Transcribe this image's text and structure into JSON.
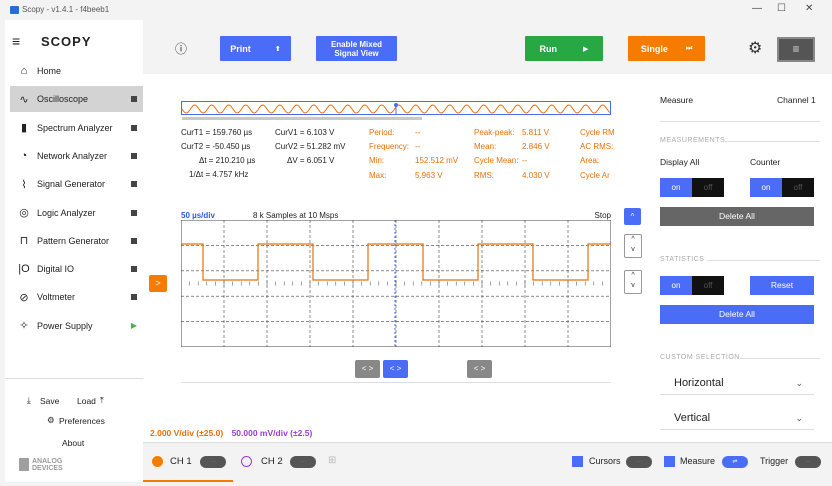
{
  "window": {
    "title": "Scopy - v1.4.1 - f4beeb1",
    "min": "—",
    "max": "☐",
    "close": "✕"
  },
  "brand": "SCOPY",
  "nav": [
    {
      "label": "Home",
      "icon": "home-icon",
      "glyph": "⌂"
    },
    {
      "label": "Oscilloscope",
      "icon": "oscilloscope-icon",
      "glyph": "∿"
    },
    {
      "label": "Spectrum Analyzer",
      "icon": "spectrum-icon",
      "glyph": "▮"
    },
    {
      "label": "Network Analyzer",
      "icon": "network-icon",
      "glyph": "◔"
    },
    {
      "label": "Signal Generator",
      "icon": "signal-icon",
      "glyph": "⌇"
    },
    {
      "label": "Logic Analyzer",
      "icon": "logic-icon",
      "glyph": "◎"
    },
    {
      "label": "Pattern Generator",
      "icon": "pattern-icon",
      "glyph": "⊓"
    },
    {
      "label": "Digital IO",
      "icon": "digital-io-icon",
      "glyph": "|O"
    },
    {
      "label": "Voltmeter",
      "icon": "voltmeter-icon",
      "glyph": "⊘"
    },
    {
      "label": "Power Supply",
      "icon": "power-icon",
      "glyph": "✧"
    }
  ],
  "sidebar_footer": {
    "save": "Save",
    "load": "Load",
    "preferences": "Preferences",
    "about": "About",
    "logo_line1": "ANALOG",
    "logo_line2": "DEVICES"
  },
  "toolbar": {
    "print": "Print",
    "mixed_line1": "Enable Mixed",
    "mixed_line2": "Signal View",
    "run": "Run",
    "single": "Single"
  },
  "colors": {
    "blue": "#4a6cf7",
    "green": "#27a844",
    "orange": "#f57c00",
    "ch1": "#e8700a",
    "ch2": "#9b3bd3"
  },
  "cursors": {
    "curT1": "CurT1 = 159.760 µs",
    "curT2": "CurT2 = -50.450 µs",
    "dt": "Δt = 210.210 µs",
    "inv_dt": "1/Δt = 4.757 kHz",
    "curV1": "CurV1 = 6.103 V",
    "curV2": "CurV2 = 51.282 mV",
    "dv": "ΔV = 6.051 V"
  },
  "measurements": {
    "period_label": "Period:",
    "period_val": "--",
    "freq_label": "Frequency:",
    "freq_val": "--",
    "min_label": "Min:",
    "min_val": "152.512 mV",
    "max_label": "Max:",
    "max_val": "5.963 V",
    "pp_label": "Peak-peak:",
    "pp_val": "5.811 V",
    "mean_label": "Mean:",
    "mean_val": "2.846 V",
    "cmean_label": "Cycle Mean:",
    "cmean_val": "--",
    "rms_label": "RMS:",
    "rms_val": "4.030 V",
    "crms_label": "Cycle RM",
    "acrms_label": "AC RMS:",
    "area_label": "Area:",
    "carea_label": "Cycle Ar"
  },
  "plot": {
    "timebase": "50 µs/div",
    "samples": "8 k Samples at 10 Msps",
    "status": "Stop",
    "ch1_div": "2.000 V/div (±25.0)",
    "ch2_div": "50.000 mV/div (±2.5)",
    "ch1_marker": ">"
  },
  "bottom": {
    "ch1": "CH 1",
    "ch2": "CH 2",
    "cursors": "Cursors",
    "measure": "Measure",
    "trigger": "Trigger"
  },
  "panel": {
    "title": "Measure",
    "channel": "Channel 1",
    "sec_measurements": "MEASUREMENTS",
    "display_all": "Display All",
    "counter": "Counter",
    "on": "on",
    "off": "off",
    "delete_all": "Delete All",
    "sec_statistics": "STATISTICS",
    "reset": "Reset",
    "sec_custom": "CUSTOM SELECTION",
    "horizontal": "Horizontal",
    "vertical": "Vertical"
  }
}
